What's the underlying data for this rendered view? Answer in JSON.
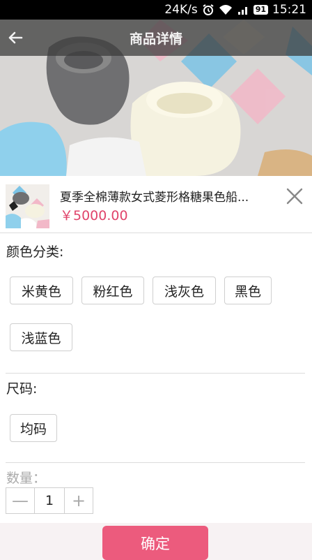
{
  "status_bar": {
    "speed": "24K/s",
    "battery": "91",
    "time": "15:21"
  },
  "appbar": {
    "title": "商品详情"
  },
  "product": {
    "name": "夏季全棉薄款女式菱形格糖果色船...",
    "price": "￥5000.00"
  },
  "color": {
    "label": "颜色分类:",
    "options": [
      "米黄色",
      "粉红色",
      "浅灰色",
      "黑色",
      "浅蓝色"
    ]
  },
  "size": {
    "label": "尺码:",
    "options": [
      "均码"
    ]
  },
  "quantity": {
    "label": "数量：",
    "value": "1",
    "minus": "—",
    "plus": "+"
  },
  "footer": {
    "confirm_label": "确定"
  },
  "icons": [
    "back-arrow-icon",
    "alarm-icon",
    "wifi-icon",
    "signal-icon",
    "battery-icon",
    "close-icon"
  ],
  "colors": {
    "accent": "#ec5b7d",
    "price": "#e0446b"
  }
}
